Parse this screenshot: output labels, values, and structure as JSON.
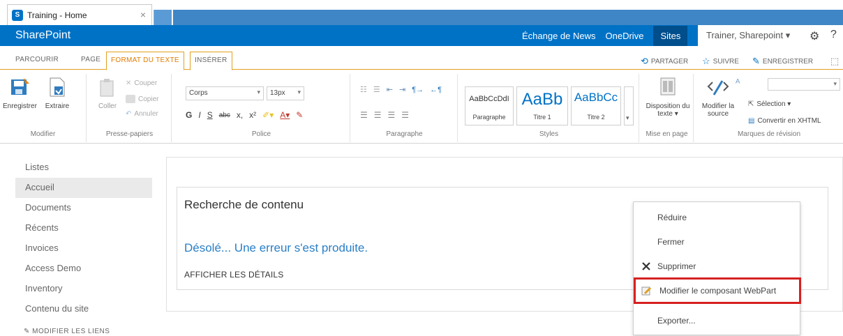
{
  "browser": {
    "tab_title": "Training - Home",
    "tab_close": "×"
  },
  "suite": {
    "brand": "SharePoint",
    "links": [
      "Échange de News",
      "OneDrive",
      "Sites"
    ],
    "user": "Trainer, Sharepoint ▾",
    "gear": "⚙",
    "help": "?"
  },
  "ribbon_tabs": {
    "browse": "PARCOURIR",
    "page": "PAGE",
    "format_text": "FORMAT DU TEXTE",
    "insert": "INSÉRER",
    "share": "PARTAGER",
    "follow": "SUIVRE",
    "save": "ENREGISTRER"
  },
  "ribbon": {
    "modify": {
      "save": "Enregistrer",
      "extract": "Extraire",
      "label": "Modifier"
    },
    "clipboard": {
      "paste": "Coller",
      "cut": "Couper",
      "copy": "Copier",
      "undo": "Annuler",
      "label": "Presse-papiers"
    },
    "font": {
      "font_name": "Corps",
      "font_size": "13px",
      "bold": "G",
      "italic": "I",
      "underline": "S",
      "strike": "abc",
      "subscript": "x,",
      "superscript": "x²",
      "label": "Police"
    },
    "paragraph": {
      "label": "Paragraphe"
    },
    "styles": {
      "items": [
        {
          "sample": "AaBbCcDdI",
          "name": "Paragraphe"
        },
        {
          "sample": "AaBb",
          "name": "Titre 1"
        },
        {
          "sample": "AaBbCc",
          "name": "Titre 2"
        }
      ],
      "label": "Styles"
    },
    "layout": {
      "text_layout": "Disposition du texte ▾",
      "label": "Mise en page"
    },
    "markup": {
      "edit_source": "Modifier la source",
      "selection": "Sélection ▾",
      "convert_xhtml": "Convertir en XHTML",
      "label": "Marques de révision"
    }
  },
  "leftnav": {
    "items": [
      "Listes",
      "Accueil",
      "Documents",
      "Récents",
      "Invoices",
      "Access Demo",
      "Inventory",
      "Contenu du site"
    ],
    "selected_index": 1,
    "edit_links": "MODIFIER LES LIENS"
  },
  "webpart": {
    "title": "Recherche de contenu",
    "error": "Désolé... Une erreur s'est produite.",
    "details": "AFFICHER LES DÉTAILS"
  },
  "context_menu": {
    "items": [
      "Réduire",
      "Fermer",
      "Supprimer",
      "Modifier le composant WebPart",
      "Exporter..."
    ],
    "highlighted_index": 3,
    "highlight_color": "#d62020"
  },
  "colors": {
    "suite_blue": "#0072c6",
    "accent_orange": "#e07c00",
    "link_blue": "#2a7fc6"
  }
}
